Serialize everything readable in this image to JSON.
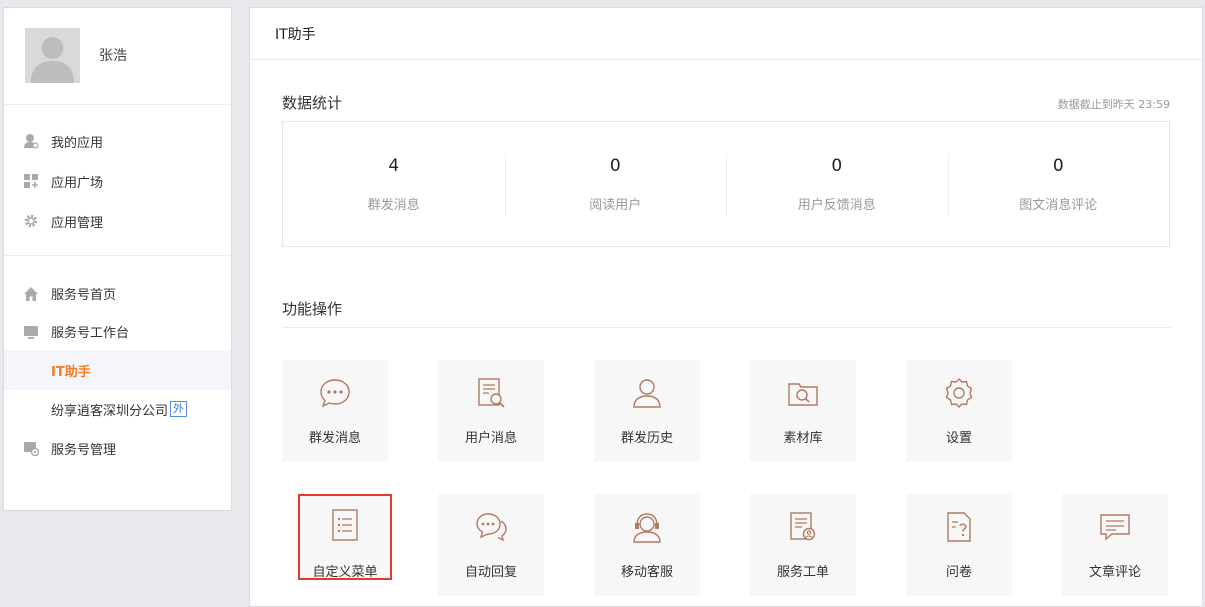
{
  "user": {
    "name": "张浩"
  },
  "sidebar": {
    "group1": [
      {
        "label": "我的应用",
        "icon": "my-apps-icon"
      },
      {
        "label": "应用广场",
        "icon": "app-plaza-icon"
      },
      {
        "label": "应用管理",
        "icon": "gear-icon"
      }
    ],
    "group2": {
      "home": {
        "label": "服务号首页",
        "icon": "home-icon"
      },
      "workbench": {
        "label": "服务号工作台",
        "icon": "monitor-icon"
      },
      "active_sub": {
        "label": "IT助手"
      },
      "ext_sub": {
        "label": "纷享逍客深圳分公司",
        "badge": "外"
      },
      "manage": {
        "label": "服务号管理",
        "icon": "manage-icon"
      }
    }
  },
  "main": {
    "title": "IT助手",
    "stats": {
      "title": "数据统计",
      "note": "数据截止到昨天 23:59",
      "items": [
        {
          "value": "4",
          "label": "群发消息"
        },
        {
          "value": "0",
          "label": "阅读用户"
        },
        {
          "value": "0",
          "label": "用户反馈消息"
        },
        {
          "value": "0",
          "label": "图文消息评论"
        }
      ]
    },
    "ops": {
      "title": "功能操作",
      "row1": [
        {
          "label": "群发消息",
          "icon": "chat-bubble-icon"
        },
        {
          "label": "用户消息",
          "icon": "document-search-icon"
        },
        {
          "label": "群发历史",
          "icon": "user-icon"
        },
        {
          "label": "素材库",
          "icon": "folder-search-icon"
        },
        {
          "label": "设置",
          "icon": "settings-icon"
        }
      ],
      "row2": [
        {
          "label": "自定义菜单",
          "icon": "menu-list-icon"
        },
        {
          "label": "自动回复",
          "icon": "double-chat-icon"
        },
        {
          "label": "移动客服",
          "icon": "headset-icon"
        },
        {
          "label": "服务工单",
          "icon": "work-order-icon"
        },
        {
          "label": "问卷",
          "icon": "questionnaire-icon"
        },
        {
          "label": "文章评论",
          "icon": "comment-icon"
        }
      ]
    }
  },
  "colors": {
    "accent": "#f57c1f",
    "highlight_border": "#e53935",
    "tile_icon": "#b07a63"
  }
}
